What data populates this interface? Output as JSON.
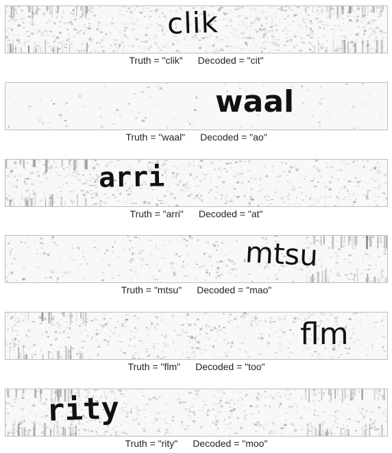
{
  "samples": [
    {
      "word": "clik",
      "caption": {
        "truth": "Truth = \"clik\"",
        "decoded": "Decoded = \"cit\""
      }
    },
    {
      "word": "waal",
      "caption": {
        "truth": "Truth = \"waal\"",
        "decoded": "Decoded = \"ao\""
      }
    },
    {
      "word": "arri",
      "caption": {
        "truth": "Truth = \"arri\"",
        "decoded": "Decoded = \"at\""
      }
    },
    {
      "word": "mtsu",
      "caption": {
        "truth": "Truth = \"mtsu\"",
        "decoded": "Decoded = \"mao\""
      }
    },
    {
      "word": "flm",
      "caption": {
        "truth": "Truth = \"flm\"",
        "decoded": "Decoded = \"too\""
      }
    },
    {
      "word": "rity",
      "caption": {
        "truth": "Truth = \"rity\"",
        "decoded": "Decoded = \"moo\""
      }
    }
  ]
}
